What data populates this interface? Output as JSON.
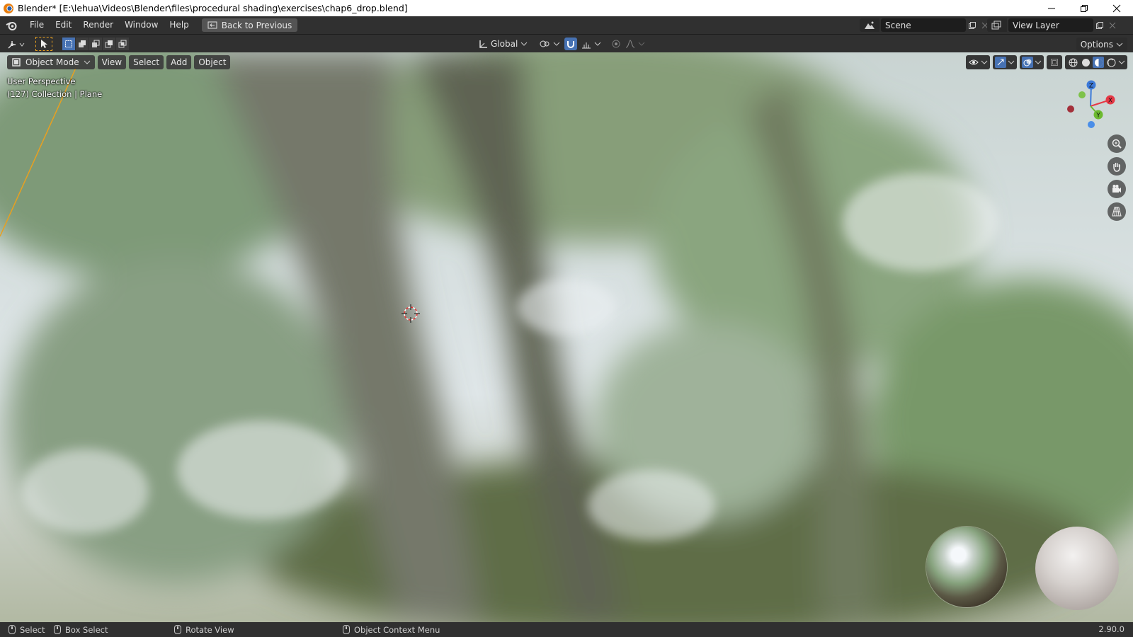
{
  "window": {
    "title": "Blender* [E:\\lehua\\Videos\\Blender\\files\\procedural shading\\exercises\\chap6_drop.blend]",
    "min_icon": "minimize-icon",
    "max_icon": "restore-icon",
    "close_icon": "close-icon"
  },
  "menubar": {
    "items": [
      "File",
      "Edit",
      "Render",
      "Window",
      "Help"
    ],
    "back_button": "Back to Previous",
    "scene": "Scene",
    "view_layer": "View Layer"
  },
  "toolheader": {
    "orientation": "Global",
    "options": "Options"
  },
  "viewport": {
    "mode": "Object Mode",
    "menus": [
      "View",
      "Select",
      "Add",
      "Object"
    ],
    "info_line1": "User Perspective",
    "info_line2": "(127) Collection | Plane",
    "gizmo_axes": {
      "x": "X",
      "y": "Y",
      "z": "Z"
    }
  },
  "statusbar": {
    "select": "Select",
    "box_select": "Box Select",
    "rotate_view": "Rotate View",
    "context_menu": "Object Context Menu",
    "version": "2.90.0"
  },
  "colors": {
    "accent": "#4772b3",
    "header_bg": "#303030",
    "axis_x": "#e63946",
    "axis_y": "#6cba2f",
    "axis_z": "#3c7ad9",
    "selection_outline": "#e8a020"
  }
}
